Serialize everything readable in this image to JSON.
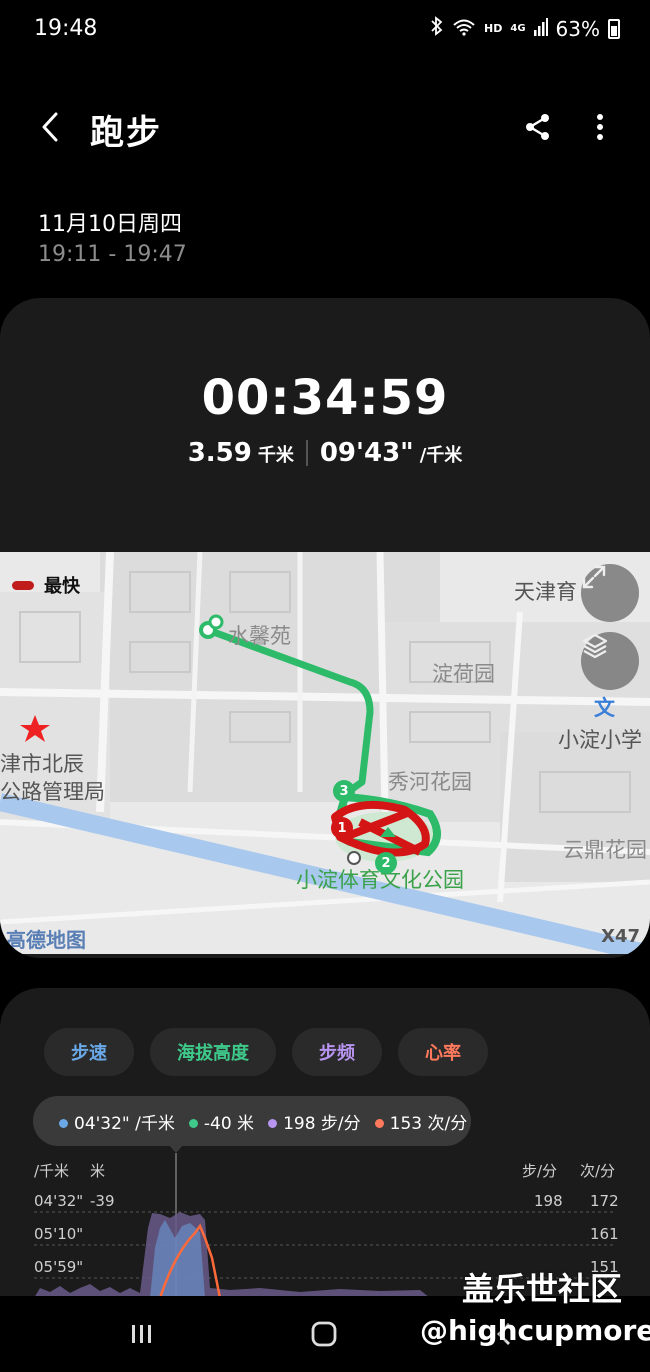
{
  "status_bar": {
    "time": "19:48",
    "battery": "63%",
    "network": "HD",
    "signal_label": "4G"
  },
  "header": {
    "title": "跑步"
  },
  "session": {
    "date": "11月10日周四",
    "time_range": "19:11 - 19:47"
  },
  "summary": {
    "duration": "00:34:59",
    "distance": "3.59",
    "distance_unit": "千米",
    "pace": "09'43\"",
    "pace_unit": "/千米"
  },
  "map": {
    "legend_label": "最快",
    "labels": {
      "tianjin": "天津育",
      "shuixinyuan": "水馨苑",
      "dianheyuan": "淀荷园",
      "wen": "文",
      "xiaodian_school": "小淀小学",
      "beichen_1": "津市北辰",
      "beichen_2": "公路管理局",
      "xiuhe": "秀河花园",
      "yunding": "云鼎花园",
      "park": "小淀体育文化公园",
      "amap": "高德地图",
      "x47": "X47"
    },
    "markers": [
      "1",
      "2",
      "3"
    ],
    "colors": {
      "route": "#2dbb6a",
      "fastest": "#d41515"
    }
  },
  "chart": {
    "tabs": [
      {
        "label": "步速",
        "color": "#6aa8e8"
      },
      {
        "label": "海拔高度",
        "color": "#3ec98a"
      },
      {
        "label": "步频",
        "color": "#b895f0"
      },
      {
        "label": "心率",
        "color": "#ff7a5c"
      }
    ],
    "tooltip": {
      "pace": "04'32\" /千米",
      "altitude": "-40 米",
      "cadence": "198 步/分",
      "heart_rate": "153 次/分"
    },
    "axis": {
      "left_unit_1": "/千米",
      "left_unit_2": "米",
      "right_unit_1": "步/分",
      "right_unit_2": "次/分",
      "rows": [
        {
          "pace": "04'32\"",
          "alt": "-39",
          "cadence": "198",
          "hr": "172"
        },
        {
          "pace": "05'10\"",
          "alt": "",
          "cadence": "",
          "hr": "161"
        },
        {
          "pace": "05'59\"",
          "alt": "",
          "cadence": "",
          "hr": "151"
        }
      ]
    }
  },
  "watermark": {
    "line1": "盖乐世社区",
    "line2": "@highcupmore"
  }
}
